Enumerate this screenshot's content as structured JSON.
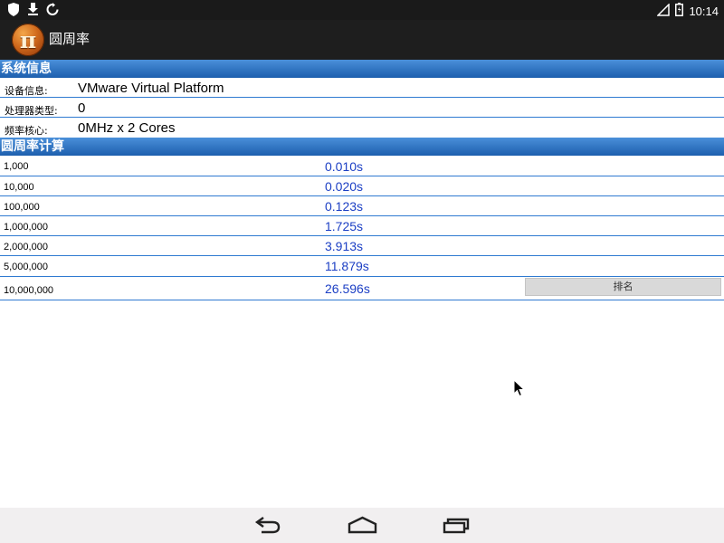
{
  "status_bar": {
    "time": "10:14",
    "left_icons": [
      "shield-icon",
      "download-icon",
      "sync-icon"
    ],
    "right_icons": [
      "signal-icon",
      "battery-icon"
    ]
  },
  "app": {
    "title": "圆周率",
    "icon_glyph": "π"
  },
  "system_info": {
    "header": "系统信息",
    "rows": [
      {
        "label": "设备信息:",
        "value": "VMware Virtual Platform"
      },
      {
        "label": "处理器类型:",
        "value": "0"
      },
      {
        "label": "频率核心:",
        "value": "0MHz x 2 Cores"
      }
    ]
  },
  "pi_calc": {
    "header": "圆周率计算",
    "rows": [
      {
        "digits": "1,000",
        "time": "0.010s"
      },
      {
        "digits": "10,000",
        "time": "0.020s"
      },
      {
        "digits": "100,000",
        "time": "0.123s"
      },
      {
        "digits": "1,000,000",
        "time": "1.725s"
      },
      {
        "digits": "2,000,000",
        "time": "3.913s"
      },
      {
        "digits": "5,000,000",
        "time": "11.879s"
      },
      {
        "digits": "10,000,000",
        "time": "26.596s"
      }
    ],
    "rank_button": "排名"
  },
  "nav_bar": {
    "buttons": [
      "back-icon",
      "home-icon",
      "recents-icon"
    ]
  },
  "colors": {
    "header_blue": "#1d5fae",
    "divider_blue": "#2f7ad1",
    "time_blue": "#1c3fc4",
    "action_bar": "#1e1e1e"
  }
}
